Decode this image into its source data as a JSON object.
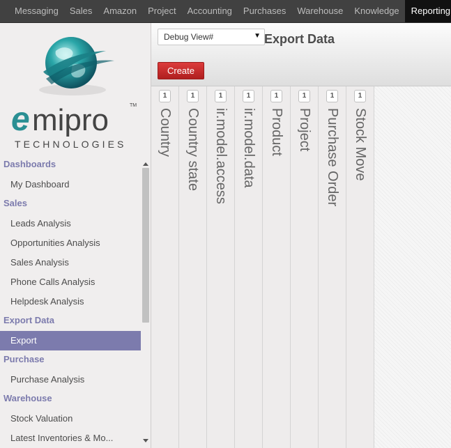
{
  "topnav": {
    "items": [
      "Messaging",
      "Sales",
      "Amazon",
      "Project",
      "Accounting",
      "Purchases",
      "Warehouse",
      "Knowledge",
      "Reporting"
    ],
    "active": "Reporting"
  },
  "logo": {
    "brand": "emipro",
    "tagline": "TECHNOLOGIES",
    "tm": "TM"
  },
  "sidebar": {
    "sections": [
      {
        "title": "Dashboards",
        "items": [
          "My Dashboard"
        ]
      },
      {
        "title": "Sales",
        "items": [
          "Leads Analysis",
          "Opportunities Analysis",
          "Sales Analysis",
          "Phone Calls Analysis",
          "Helpdesk Analysis"
        ]
      },
      {
        "title": "Export Data",
        "items": [
          "Export"
        ]
      },
      {
        "title": "Purchase",
        "items": [
          "Purchase Analysis"
        ]
      },
      {
        "title": "Warehouse",
        "items": [
          "Stock Valuation",
          "Latest Inventories & Mo..."
        ]
      }
    ],
    "active_item": "Export"
  },
  "header": {
    "view_select": "Debug View#",
    "title": "Export Data",
    "create_label": "Create"
  },
  "columns": [
    {
      "label": "Country",
      "count": "1"
    },
    {
      "label": "Country state",
      "count": "1"
    },
    {
      "label": "ir.model.access",
      "count": "1"
    },
    {
      "label": "ir.model.data",
      "count": "1"
    },
    {
      "label": "Product",
      "count": "1"
    },
    {
      "label": "Project",
      "count": "1"
    },
    {
      "label": "Purchase Order",
      "count": "1"
    },
    {
      "label": "Stock Move",
      "count": "1"
    }
  ],
  "colors": {
    "accent": "#7c7bad",
    "create": "#c72929",
    "topbar": "#414141"
  }
}
